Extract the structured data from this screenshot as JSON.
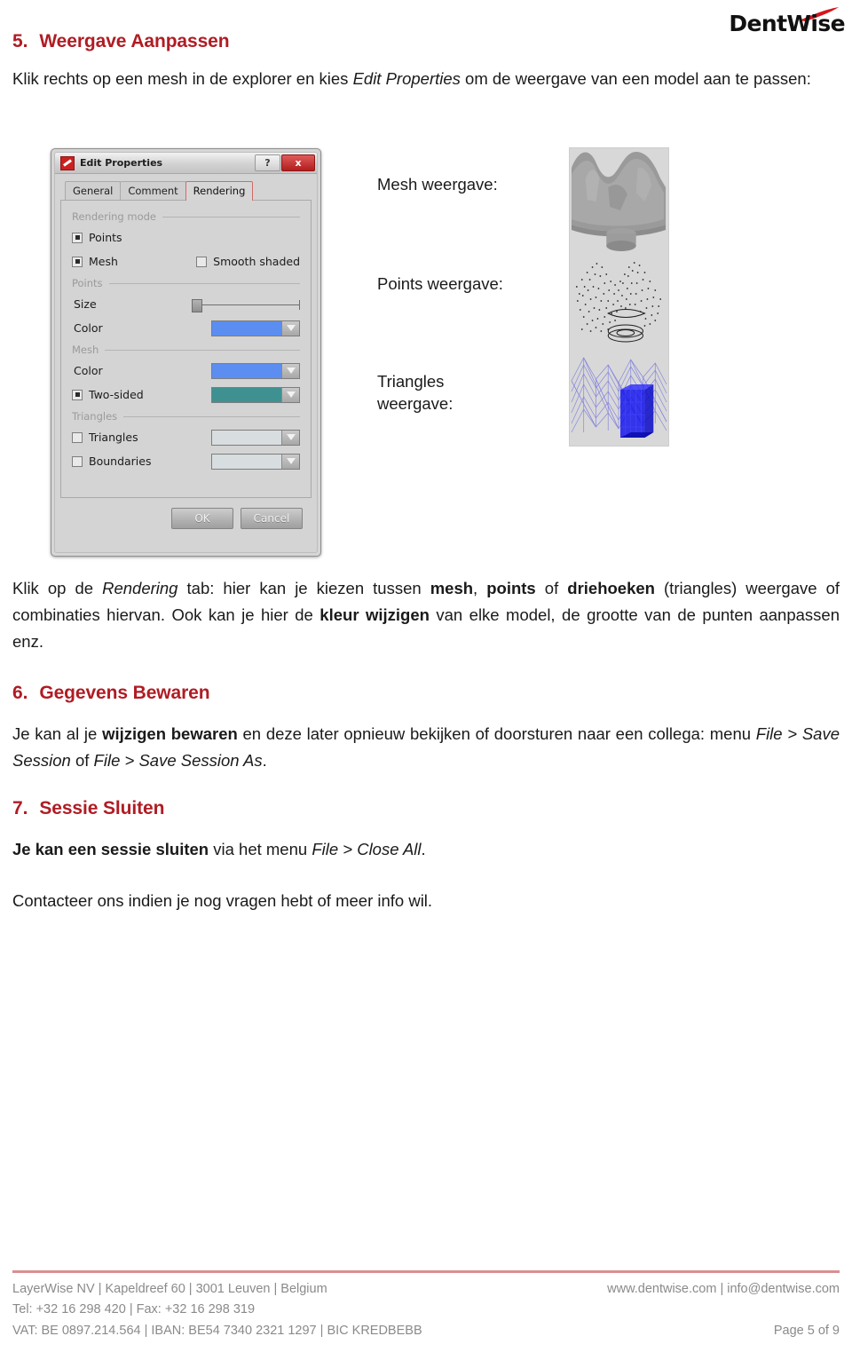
{
  "logo": {
    "text": "DentWise",
    "swoosh_color": "#d6151c"
  },
  "theme": {
    "heading_red": "#b01c24",
    "footer_gray": "#8a8a8a",
    "footer_rule": "#d98f93"
  },
  "sections": [
    {
      "number": "5.",
      "title": "Weergave Aanpassen"
    },
    {
      "number": "6.",
      "title": "Gegevens Bewaren"
    },
    {
      "number": "7.",
      "title": "Sessie Sluiten"
    }
  ],
  "intro": {
    "part1": "Klik rechts op een mesh in de explorer en kies ",
    "italic": "Edit Properties",
    "part2": " om de weergave van een model aan te passen:"
  },
  "dialog": {
    "title": "Edit Properties",
    "help_button": "?",
    "close_button": "x",
    "tabs": [
      {
        "label": "General",
        "active": false
      },
      {
        "label": "Comment",
        "active": false
      },
      {
        "label": "Rendering",
        "active": true
      }
    ],
    "groups": [
      {
        "name": "Rendering mode"
      },
      {
        "name": "Points"
      },
      {
        "name": "Mesh"
      },
      {
        "name": "Triangles"
      }
    ],
    "rendering_mode": {
      "points": {
        "label": "Points",
        "checked": true
      },
      "mesh": {
        "label": "Mesh",
        "checked": true
      },
      "smooth_shaded": {
        "label": "Smooth shaded",
        "checked": false
      }
    },
    "points_group": {
      "size_label": "Size",
      "color_label": "Color",
      "color_value": "#5b8ef0"
    },
    "mesh_group": {
      "color_label": "Color",
      "color_value": "#5b8ef0",
      "two_sided_label": "Two-sided",
      "two_sided_checked": true,
      "two_sided_color": "#3f9191"
    },
    "triangles_group": {
      "triangles_label": "Triangles",
      "triangles_checked": false,
      "triangles_color": "#d8dde0",
      "boundaries_label": "Boundaries",
      "boundaries_checked": false,
      "boundaries_color": "#d8dde0"
    },
    "buttons": {
      "ok": "OK",
      "cancel": "Cancel"
    }
  },
  "figure_labels": {
    "mesh": "Mesh weergave:",
    "points": "Points weergave:",
    "triangles_line1": "Triangles",
    "triangles_line2": "weergave:"
  },
  "paragraph_rendering": {
    "t1": "Klik op de ",
    "i1": "Rendering",
    "t2": " tab: hier kan je kiezen tussen ",
    "b1": "mesh",
    "t3": ", ",
    "b2": "points",
    "t4": " of ",
    "b3": "driehoeken",
    "t5": " (triangles) weergave of combinaties hiervan. Ook kan je hier de ",
    "b4": "kleur wijzigen",
    "t6": " van elke model, de grootte van de punten aanpassen enz."
  },
  "paragraph_bewaren": {
    "t1": "Je kan al je ",
    "b1": "wijzigen bewaren",
    "t2": " en deze later opnieuw bekijken of doorsturen naar een collega: menu ",
    "i1": "File > Save Session",
    "t3": " of ",
    "i2": "File > Save Session As",
    "t4": "."
  },
  "paragraph_sluiten": {
    "b1": "Je kan een sessie sluiten",
    "t1": " via het menu ",
    "i1": "File > Close All",
    "t2": "."
  },
  "paragraph_contact": {
    "text": "Contacteer ons indien je nog vragen hebt of meer info wil."
  },
  "footer": {
    "line1": "LayerWise NV | Kapeldreef 60 | 3001 Leuven | Belgium",
    "line2": "Tel: +32 16 298 420 | Fax: +32 16 298 319",
    "line3": "VAT: BE 0897.214.564 | IBAN: BE54 7340 2321 1297 | BIC KREDBEBB",
    "website": "www.dentwise.com | info@dentwise.com",
    "page": "Page 5 of 9"
  }
}
